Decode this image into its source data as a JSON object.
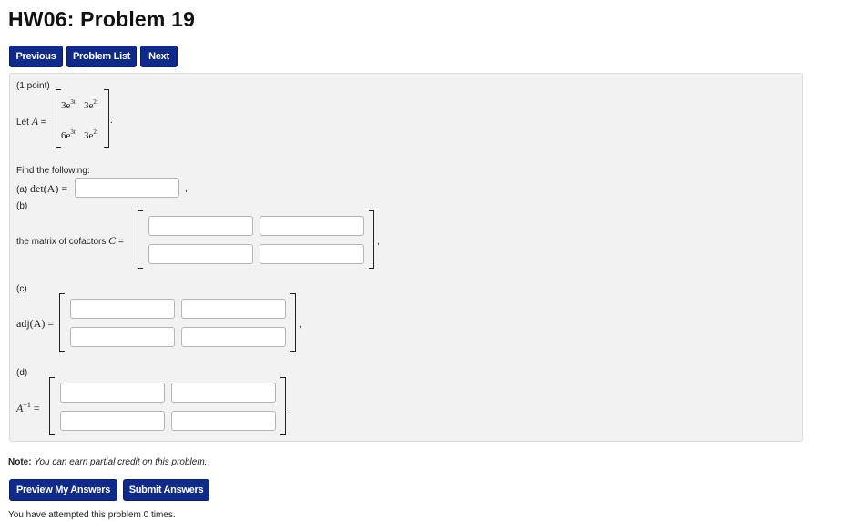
{
  "page": {
    "title": "HW06: Problem 19"
  },
  "nav": {
    "previous": "Previous",
    "problem_list": "Problem List",
    "next": "Next"
  },
  "problem": {
    "points": "(1 point)",
    "let_label": "Let",
    "matrix_A": [
      [
        "3e^{3t}",
        "3e^{2t}"
      ],
      [
        "6e^{3t}",
        "3e^{2t}"
      ]
    ],
    "entries": {
      "a11_base": "3e",
      "a11_exp": "3t",
      "a12_base": "3e",
      "a12_exp": "2t",
      "a21_base": "6e",
      "a21_exp": "3t",
      "a22_base": "3e",
      "a22_exp": "2t"
    },
    "find_text": "Find the following:",
    "part_a_label": "(a)",
    "part_a_expr": "det(A) =",
    "part_b_label": "(b)",
    "part_b_text": "the matrix of cofactors",
    "part_c_label": "(c)",
    "part_c_expr": "adj(A) =",
    "part_d_label": "(d)",
    "part_d_sup": "−1",
    "answers": {
      "det": "",
      "cofactors": [
        "",
        "",
        "",
        ""
      ],
      "adj": [
        "",
        "",
        "",
        ""
      ],
      "inverse": [
        "",
        "",
        "",
        ""
      ]
    }
  },
  "note": {
    "label": "Note:",
    "text": "You can earn partial credit on this problem."
  },
  "actions": {
    "preview": "Preview My Answers",
    "submit": "Submit Answers"
  },
  "status": {
    "attempts": "You have attempted this problem 0 times."
  }
}
